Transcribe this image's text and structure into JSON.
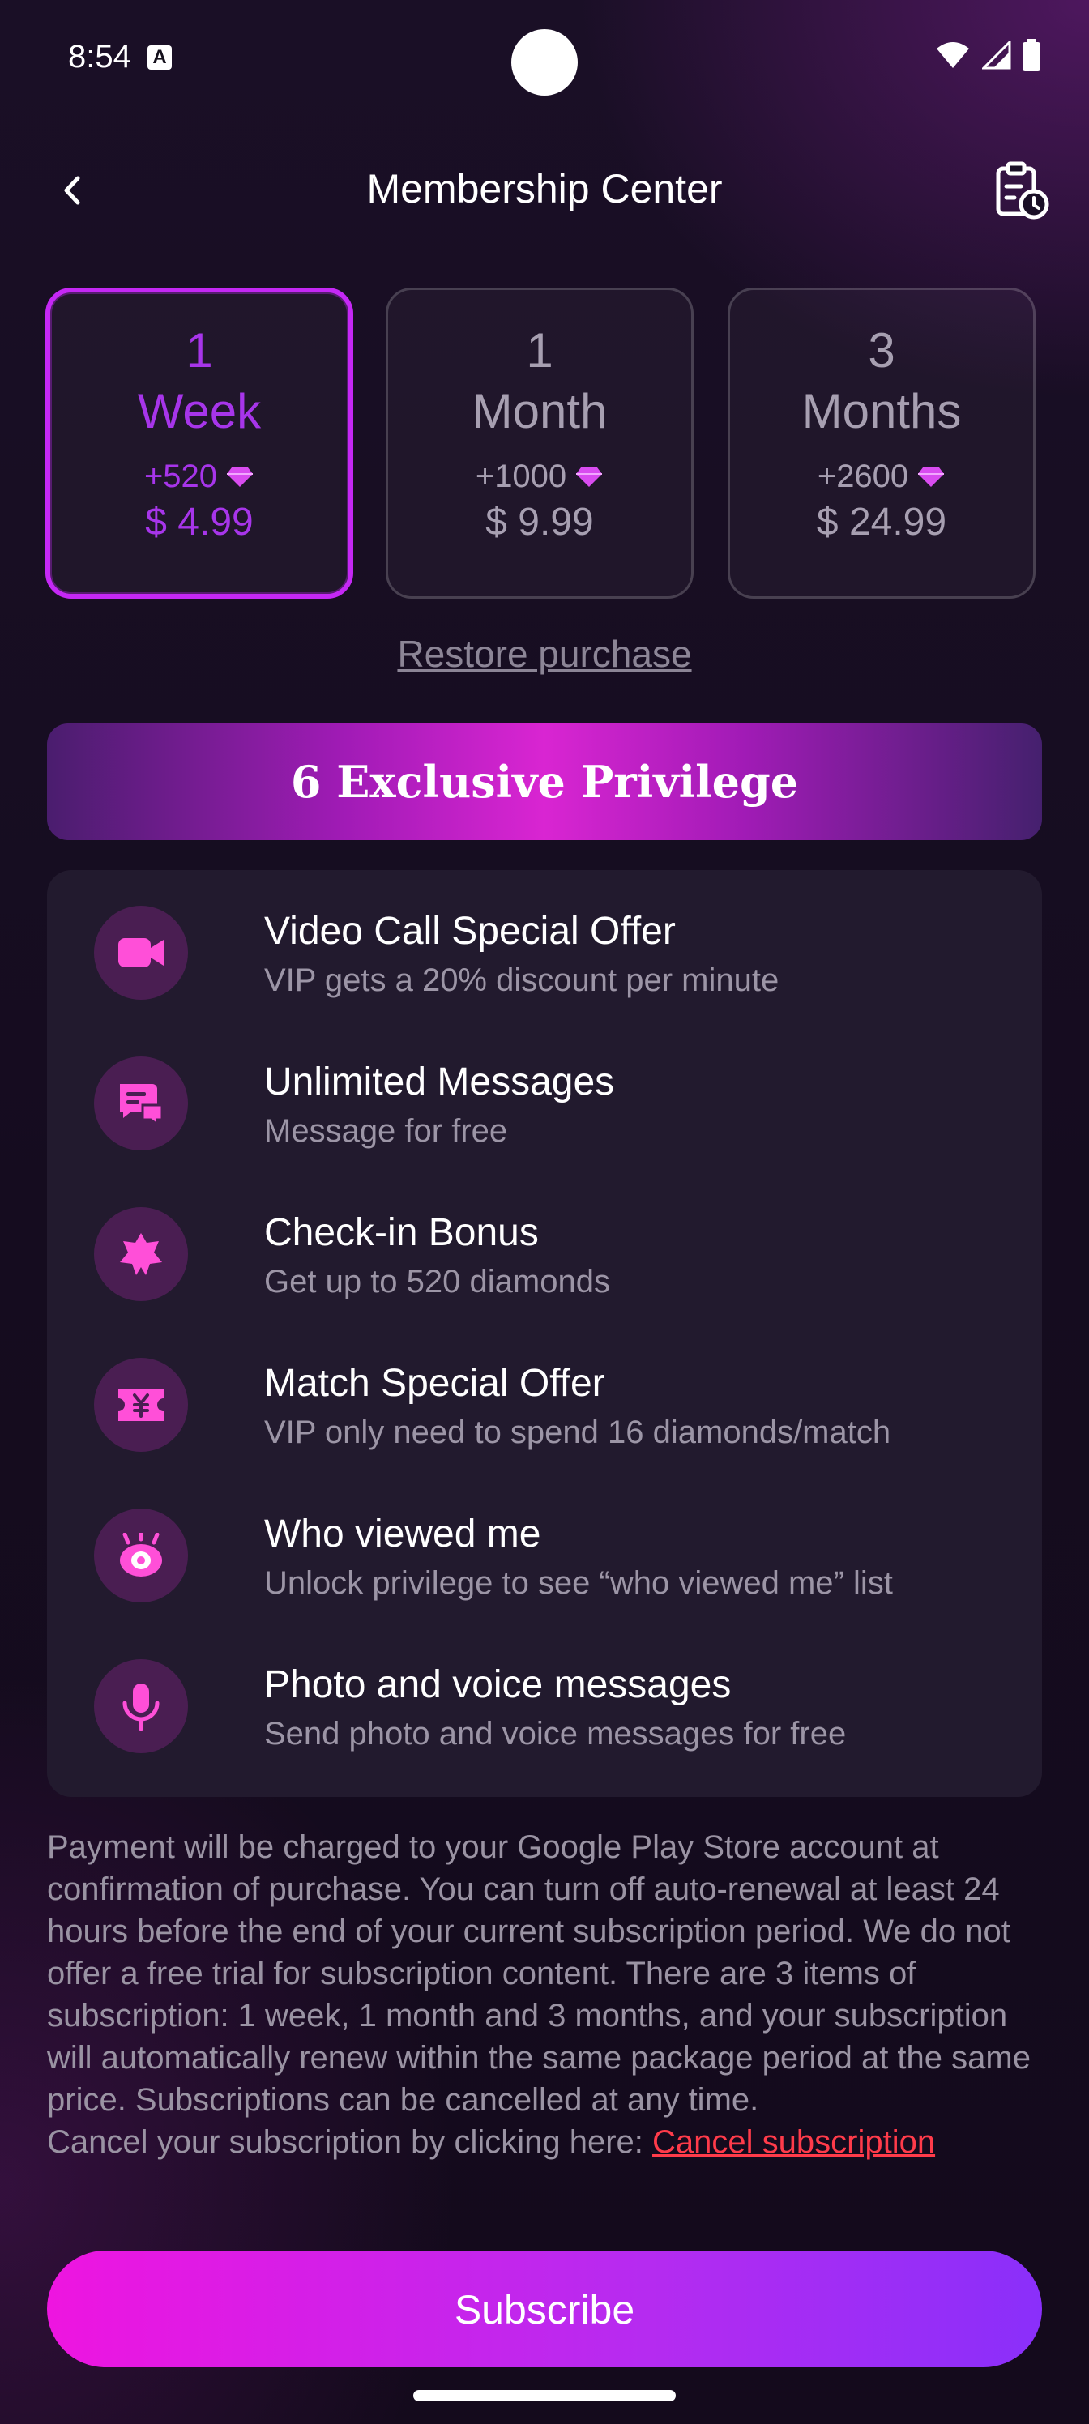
{
  "status_bar": {
    "time": "8:54",
    "notification_icon": "A"
  },
  "header": {
    "title": "Membership Center",
    "back_icon": "chevron-left-icon",
    "history_icon": "clipboard-clock-icon"
  },
  "plans": [
    {
      "qty": "1",
      "unit": "Week",
      "bonus": "+520",
      "price": "$ 4.99",
      "selected": true
    },
    {
      "qty": "1",
      "unit": "Month",
      "bonus": "+1000",
      "price": "$ 9.99",
      "selected": false
    },
    {
      "qty": "3",
      "unit": "Months",
      "bonus": "+2600",
      "price": "$ 24.99",
      "selected": false
    }
  ],
  "restore_label": "Restore purchase",
  "privileges_banner": "6 Exclusive Privilege",
  "privileges": [
    {
      "title": "Video Call Special Offer",
      "desc": "VIP gets a 20% discount per minute",
      "icon": "video-camera-icon"
    },
    {
      "title": "Unlimited Messages",
      "desc": "Message for free",
      "icon": "chat-bubbles-icon"
    },
    {
      "title": "Check-in Bonus",
      "desc": "Get up to 520 diamonds",
      "icon": "star-badge-icon"
    },
    {
      "title": "Match Special Offer",
      "desc": "VIP only need to spend 16 diamonds/match",
      "icon": "ticket-yen-icon"
    },
    {
      "title": "Who viewed me",
      "desc": "Unlock privilege to see “who viewed me” list",
      "icon": "eye-icon"
    },
    {
      "title": "Photo and voice messages",
      "desc": "Send photo and voice messages for free",
      "icon": "microphone-icon"
    }
  ],
  "terms": {
    "text": "Payment will be charged to your Google Play Store account at confirmation of purchase. You can turn off auto-renewal at least 24 hours before the end of your current subscription period. We do not offer a free trial for subscription content. There are 3 items of subscription: 1 week, 1 month and 3 months, and your subscription will automatically renew within the same package period at the same price. Subscriptions can be cancelled at any time.",
    "cancel_prefix": "Cancel your subscription by clicking here: ",
    "cancel_link": "Cancel subscription"
  },
  "subscribe_label": "Subscribe",
  "colors": {
    "accent": "#c528f5",
    "link": "#ff3b4a",
    "button_start": "#ee15e0",
    "button_end": "#8a2ffa"
  }
}
